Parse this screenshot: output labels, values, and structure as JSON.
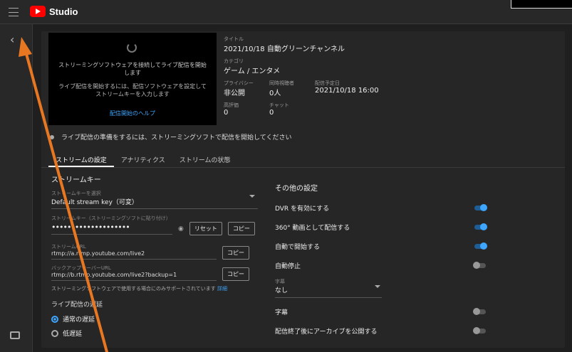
{
  "app": {
    "title": "Studio"
  },
  "preview": {
    "message1": "ストリーミングソフトウェアを接続してライブ配信を開始します",
    "message2": "ライブ配信を開始するには、配信ソフトウェアを設定してストリームキーを入力します",
    "help_link": "配信開始のヘルプ"
  },
  "details": {
    "title_label": "タイトル",
    "title_value": "2021/10/18 自動グリーンチャンネル",
    "category_label": "カテゴリ",
    "category_value": "ゲーム / エンタメ",
    "privacy_label": "プライバシー",
    "privacy_value": "非公開",
    "viewers_label": "同時視聴者",
    "viewers_value": "0人",
    "date_label": "配信予定日",
    "date_value": "2021/10/18 16:00",
    "likes_label": "高評価",
    "likes_value": "0",
    "chat_label": "チャット",
    "chat_value": "0"
  },
  "notice": "ライブ配信の準備をするには、ストリーミングソフトで配信を開始してください",
  "tabs": [
    "ストリームの設定",
    "アナリティクス",
    "ストリームの状態"
  ],
  "left": {
    "section_title": "ストリームキー",
    "key_select_label": "ストリームキーを選択",
    "key_select_value": "Default stream key（可変）",
    "key_label": "ストリームキー（ストリーミングソフトに貼り付け）",
    "key_value": "••••••••••••••••••••",
    "reset_button": "リセット",
    "copy_button": "コピー",
    "url_label": "ストリームURL",
    "url_value": "rtmp://a.rtmp.youtube.com/live2",
    "backup_label": "バックアップサーバーURL",
    "backup_value": "rtmp://b.rtmp.youtube.com/live2?backup=1",
    "copy_button2": "コピー",
    "copy_button3": "コピー",
    "note_text": "ストリーミングソフトウェアで使用する場合にのみサポートされています",
    "note_link": "詳細",
    "latency_title": "ライブ配信の遅延",
    "latency_options": [
      "通常の遅延",
      "低遅延"
    ]
  },
  "right": {
    "section_title": "その他の設定",
    "rows": [
      {
        "label": "DVR を有効にする",
        "on": true
      },
      {
        "label": "360° 動画として配信する",
        "on": true
      },
      {
        "label": "自動で開始する",
        "on": true
      },
      {
        "label": "自動停止",
        "on": false
      }
    ],
    "select_label": "字幕",
    "select_value": "なし",
    "rows2": [
      {
        "label": "字幕",
        "on": false
      },
      {
        "label": "配信終了後にアーカイブを公開する",
        "on": false
      }
    ]
  }
}
